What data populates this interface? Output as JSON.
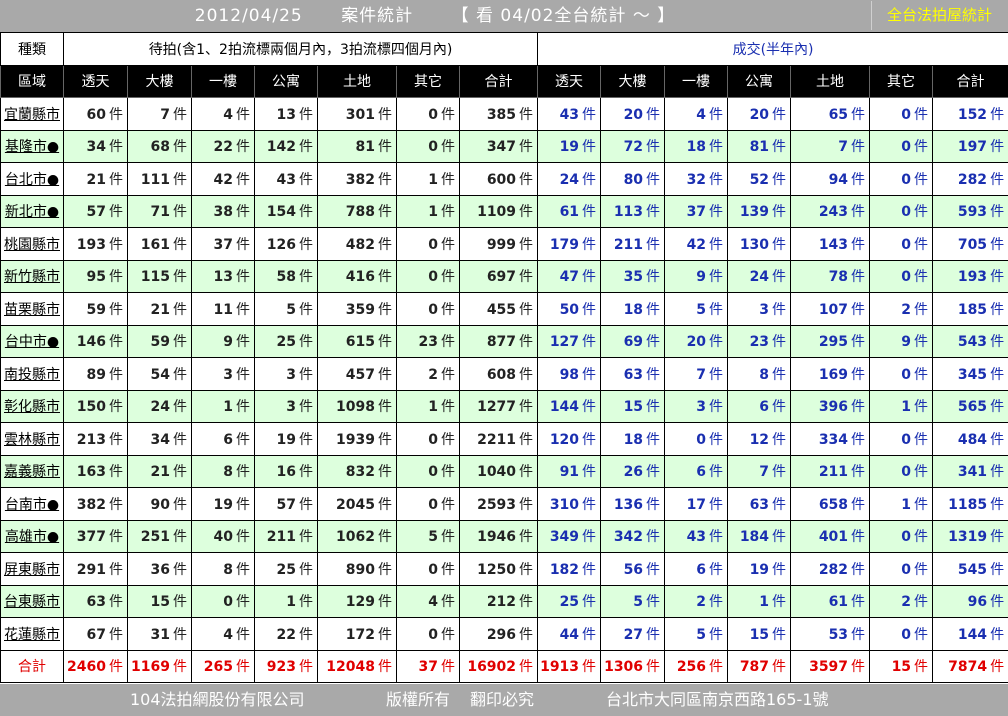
{
  "title": {
    "date": "2012/04/25",
    "label": "案件統計",
    "view_link": "【 看 04/02全台統計 ～ 】",
    "nationwide_button": "全台法拍屋統計"
  },
  "header": {
    "type_label": "種類",
    "pending_label": "待拍(含1、2拍流標兩個月內，3拍流標四個月內)",
    "deal_label": "成交(半年內)",
    "region_label": "區域",
    "columns": [
      "透天",
      "大樓",
      "一樓",
      "公寓",
      "土地",
      "其它",
      "合計",
      "透天",
      "大樓",
      "一樓",
      "公寓",
      "土地",
      "其它",
      "合計"
    ]
  },
  "unit": "件",
  "rows": [
    {
      "region": "宜蘭縣市",
      "pending": [
        "60",
        "7",
        "4",
        "13",
        "301",
        "0",
        "385"
      ],
      "deal": [
        "43",
        "20",
        "4",
        "20",
        "65",
        "0",
        "152"
      ]
    },
    {
      "region": "基隆市●",
      "pending": [
        "34",
        "68",
        "22",
        "142",
        "81",
        "0",
        "347"
      ],
      "deal": [
        "19",
        "72",
        "18",
        "81",
        "7",
        "0",
        "197"
      ]
    },
    {
      "region": "台北市●",
      "pending": [
        "21",
        "111",
        "42",
        "43",
        "382",
        "1",
        "600"
      ],
      "deal": [
        "24",
        "80",
        "32",
        "52",
        "94",
        "0",
        "282"
      ]
    },
    {
      "region": "新北市●",
      "pending": [
        "57",
        "71",
        "38",
        "154",
        "788",
        "1",
        "1109"
      ],
      "deal": [
        "61",
        "113",
        "37",
        "139",
        "243",
        "0",
        "593"
      ]
    },
    {
      "region": "桃園縣市",
      "pending": [
        "193",
        "161",
        "37",
        "126",
        "482",
        "0",
        "999"
      ],
      "deal": [
        "179",
        "211",
        "42",
        "130",
        "143",
        "0",
        "705"
      ]
    },
    {
      "region": "新竹縣市",
      "pending": [
        "95",
        "115",
        "13",
        "58",
        "416",
        "0",
        "697"
      ],
      "deal": [
        "47",
        "35",
        "9",
        "24",
        "78",
        "0",
        "193"
      ]
    },
    {
      "region": "苗栗縣市",
      "pending": [
        "59",
        "21",
        "11",
        "5",
        "359",
        "0",
        "455"
      ],
      "deal": [
        "50",
        "18",
        "5",
        "3",
        "107",
        "2",
        "185"
      ]
    },
    {
      "region": "台中市●",
      "pending": [
        "146",
        "59",
        "9",
        "25",
        "615",
        "23",
        "877"
      ],
      "deal": [
        "127",
        "69",
        "20",
        "23",
        "295",
        "9",
        "543"
      ]
    },
    {
      "region": "南投縣市",
      "pending": [
        "89",
        "54",
        "3",
        "3",
        "457",
        "2",
        "608"
      ],
      "deal": [
        "98",
        "63",
        "7",
        "8",
        "169",
        "0",
        "345"
      ]
    },
    {
      "region": "彰化縣市",
      "pending": [
        "150",
        "24",
        "1",
        "3",
        "1098",
        "1",
        "1277"
      ],
      "deal": [
        "144",
        "15",
        "3",
        "6",
        "396",
        "1",
        "565"
      ]
    },
    {
      "region": "雲林縣市",
      "pending": [
        "213",
        "34",
        "6",
        "19",
        "1939",
        "0",
        "2211"
      ],
      "deal": [
        "120",
        "18",
        "0",
        "12",
        "334",
        "0",
        "484"
      ]
    },
    {
      "region": "嘉義縣市",
      "pending": [
        "163",
        "21",
        "8",
        "16",
        "832",
        "0",
        "1040"
      ],
      "deal": [
        "91",
        "26",
        "6",
        "7",
        "211",
        "0",
        "341"
      ]
    },
    {
      "region": "台南市●",
      "pending": [
        "382",
        "90",
        "19",
        "57",
        "2045",
        "0",
        "2593"
      ],
      "deal": [
        "310",
        "136",
        "17",
        "63",
        "658",
        "1",
        "1185"
      ]
    },
    {
      "region": "高雄市●",
      "pending": [
        "377",
        "251",
        "40",
        "211",
        "1062",
        "5",
        "1946"
      ],
      "deal": [
        "349",
        "342",
        "43",
        "184",
        "401",
        "0",
        "1319"
      ]
    },
    {
      "region": "屏東縣市",
      "pending": [
        "291",
        "36",
        "8",
        "25",
        "890",
        "0",
        "1250"
      ],
      "deal": [
        "182",
        "56",
        "6",
        "19",
        "282",
        "0",
        "545"
      ]
    },
    {
      "region": "台東縣市",
      "pending": [
        "63",
        "15",
        "0",
        "1",
        "129",
        "4",
        "212"
      ],
      "deal": [
        "25",
        "5",
        "2",
        "1",
        "61",
        "2",
        "96"
      ]
    },
    {
      "region": "花蓮縣市",
      "pending": [
        "67",
        "31",
        "4",
        "22",
        "172",
        "0",
        "296"
      ],
      "deal": [
        "44",
        "27",
        "5",
        "15",
        "53",
        "0",
        "144"
      ]
    }
  ],
  "totals": {
    "label": "合計",
    "pending": [
      "2460",
      "1169",
      "265",
      "923",
      "12048",
      "37",
      "16902"
    ],
    "deal": [
      "1913",
      "1306",
      "256",
      "787",
      "3597",
      "15",
      "7874"
    ]
  },
  "footer": {
    "company": "104法拍網股份有限公司",
    "rights": "版權所有",
    "no_copy": "翻印必究",
    "address": "台北市大同區南京西路165-1號"
  },
  "colors": {
    "title_bar": "#a9a9a9",
    "title_text": "#ffffff",
    "link_text": "#ffff00",
    "header_bg": "#000000",
    "alt_row": "#ddffdd",
    "deal_text": "#1a2fb0",
    "total_text": "#e00000"
  }
}
